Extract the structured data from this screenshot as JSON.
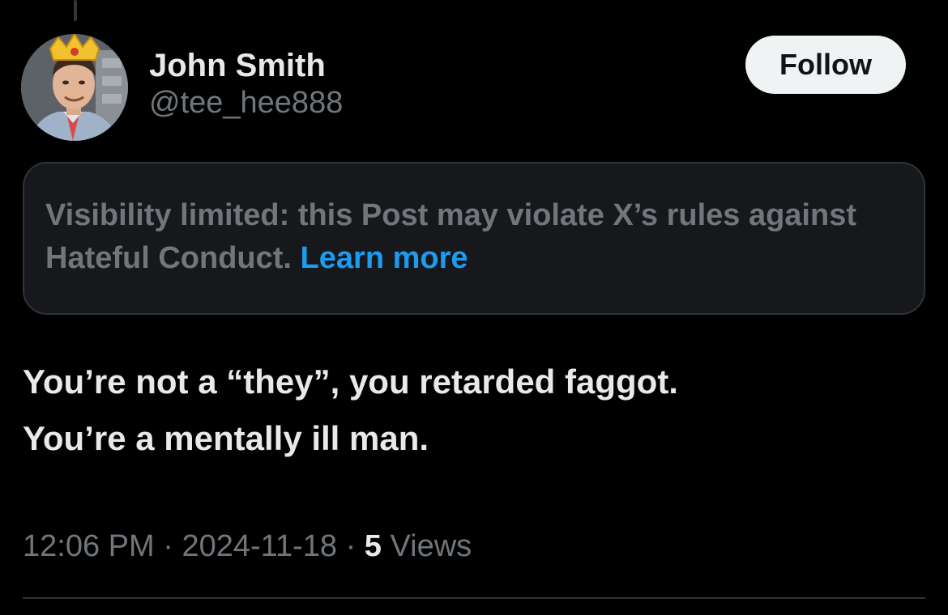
{
  "post": {
    "author": {
      "display_name": "John Smith",
      "handle": "@tee_hee888",
      "avatar": "profile-photo-with-paper-crown"
    },
    "follow_label": "Follow",
    "notice": {
      "text": "Visibility limited: this Post may violate X’s rules against Hateful Conduct.",
      "link_label": "Learn more"
    },
    "body": {
      "line1": "You’re not a “they”, you retarded faggot.",
      "line2": "You’re a mentally ill man."
    },
    "meta": {
      "time": "12:06 PM",
      "separator": "·",
      "date": "2024-11-18",
      "views_count": "5",
      "views_label": "Views"
    }
  },
  "colors": {
    "background": "#000000",
    "primary_text": "#e7e9ea",
    "secondary_text": "#71767b",
    "link": "#1d9bf0",
    "notice_bg": "#16181c",
    "border": "#2f3336",
    "follow_bg": "#eff3f4"
  }
}
